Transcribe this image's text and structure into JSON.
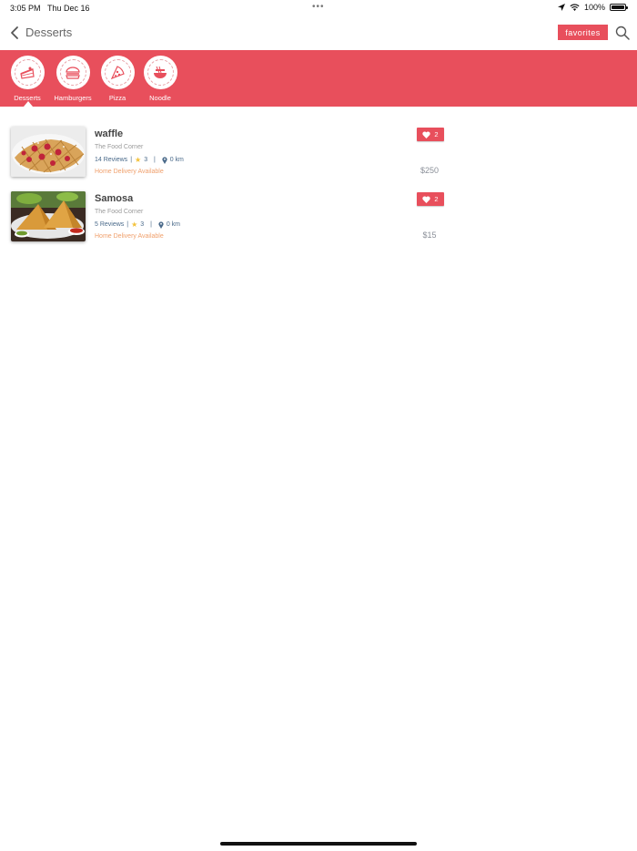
{
  "status_bar": {
    "time": "3:05 PM",
    "date": "Thu Dec 16",
    "battery": "100%"
  },
  "header": {
    "title": "Desserts",
    "favorites_label": "favorites"
  },
  "categories": [
    {
      "label": "Desserts",
      "icon": "cake-icon",
      "selected": true
    },
    {
      "label": "Hamburgers",
      "icon": "hamburger-icon",
      "selected": false
    },
    {
      "label": "Pizza",
      "icon": "pizza-icon",
      "selected": false
    },
    {
      "label": "Noodle",
      "icon": "noodle-icon",
      "selected": false
    }
  ],
  "items": [
    {
      "name": "waffle",
      "vendor": "The Food Corner",
      "reviews": "14 Reviews",
      "rating": "3",
      "distance": "0 km",
      "delivery": "Home Delivery Available",
      "likes": "2",
      "price": "$250",
      "image": "waffle-photo"
    },
    {
      "name": "Samosa",
      "vendor": "The Food Corner",
      "reviews": "5 Reviews",
      "rating": "3",
      "distance": "0 km",
      "delivery": "Home Delivery Available",
      "likes": "2",
      "price": "$15",
      "image": "samosa-photo"
    }
  ],
  "colors": {
    "brand": "#e84f5c",
    "delivery": "#f0a06c",
    "meta": "#4a6a8a"
  }
}
